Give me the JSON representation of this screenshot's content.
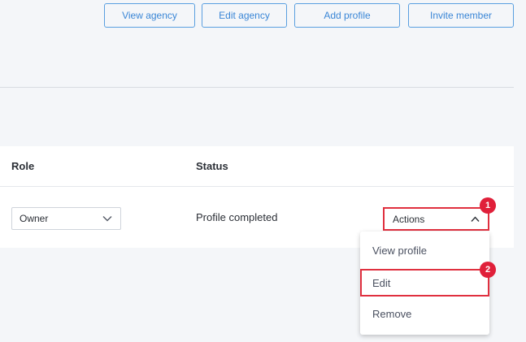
{
  "toolbar": {
    "view_agency": "View agency",
    "edit_agency": "Edit agency",
    "add_profile": "Add profile",
    "invite_member": "Invite member"
  },
  "table": {
    "columns": {
      "role": "Role",
      "status": "Status"
    },
    "rows": [
      {
        "role": "Owner",
        "status": "Profile completed",
        "actions_label": "Actions"
      }
    ]
  },
  "actions_menu": {
    "items": [
      {
        "label": "View profile"
      },
      {
        "label": "Edit"
      },
      {
        "label": "Remove"
      }
    ]
  },
  "annotations": {
    "badge_1": "1",
    "badge_2": "2"
  },
  "colors": {
    "accent_blue": "#3a86d6",
    "highlight_red": "#e0303f",
    "badge_red": "#e0203a",
    "background": "#f4f6f9"
  },
  "icons": {
    "role_select": "chevron-down-icon",
    "actions": "chevron-up-icon"
  }
}
